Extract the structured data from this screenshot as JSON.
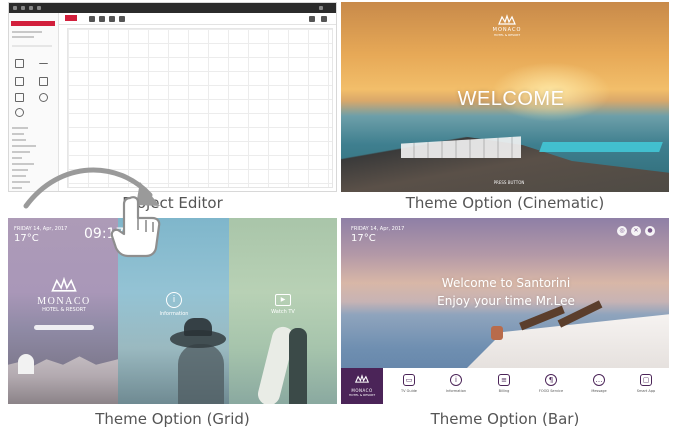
{
  "captions": {
    "editor": "Project Editor",
    "cinematic": "Theme Option (Cinematic)",
    "grid": "Theme Option (Grid)",
    "bar": "Theme Option (Bar)"
  },
  "cinematic": {
    "brand": "MONACO",
    "brand_sub": "HOTEL & RESORT",
    "welcome": "WELCOME",
    "press": "PRESS BUTTON"
  },
  "grid": {
    "date": "FRIDAY 14, Apr, 2017",
    "temp": "17°C",
    "time": "09:17",
    "brand": "MONACO",
    "brand_sub": "HOTEL & RESORT",
    "items": [
      {
        "label": "Information",
        "icon": "info-icon"
      },
      {
        "label": "Watch TV",
        "icon": "tv-icon"
      }
    ]
  },
  "bar": {
    "date": "FRIDAY 14, Apr, 2017",
    "temp": "17°C",
    "greeting_line1": "Welcome to Santorini",
    "greeting_line2": "Enjoy your time Mr.Lee",
    "brand": "MONACO",
    "brand_sub": "HOTEL & RESORT",
    "items": [
      {
        "label": "TV Guide",
        "icon": "tv-guide-icon"
      },
      {
        "label": "Information",
        "icon": "info-icon"
      },
      {
        "label": "Billing",
        "icon": "billing-icon"
      },
      {
        "label": "FOOD Service",
        "icon": "food-icon"
      },
      {
        "label": "Message",
        "icon": "message-icon"
      },
      {
        "label": "Smart App",
        "icon": "smart-app-icon"
      }
    ]
  },
  "colors": {
    "bar_brand_bg": "#4b2458",
    "editor_accent": "#d21f3c"
  }
}
